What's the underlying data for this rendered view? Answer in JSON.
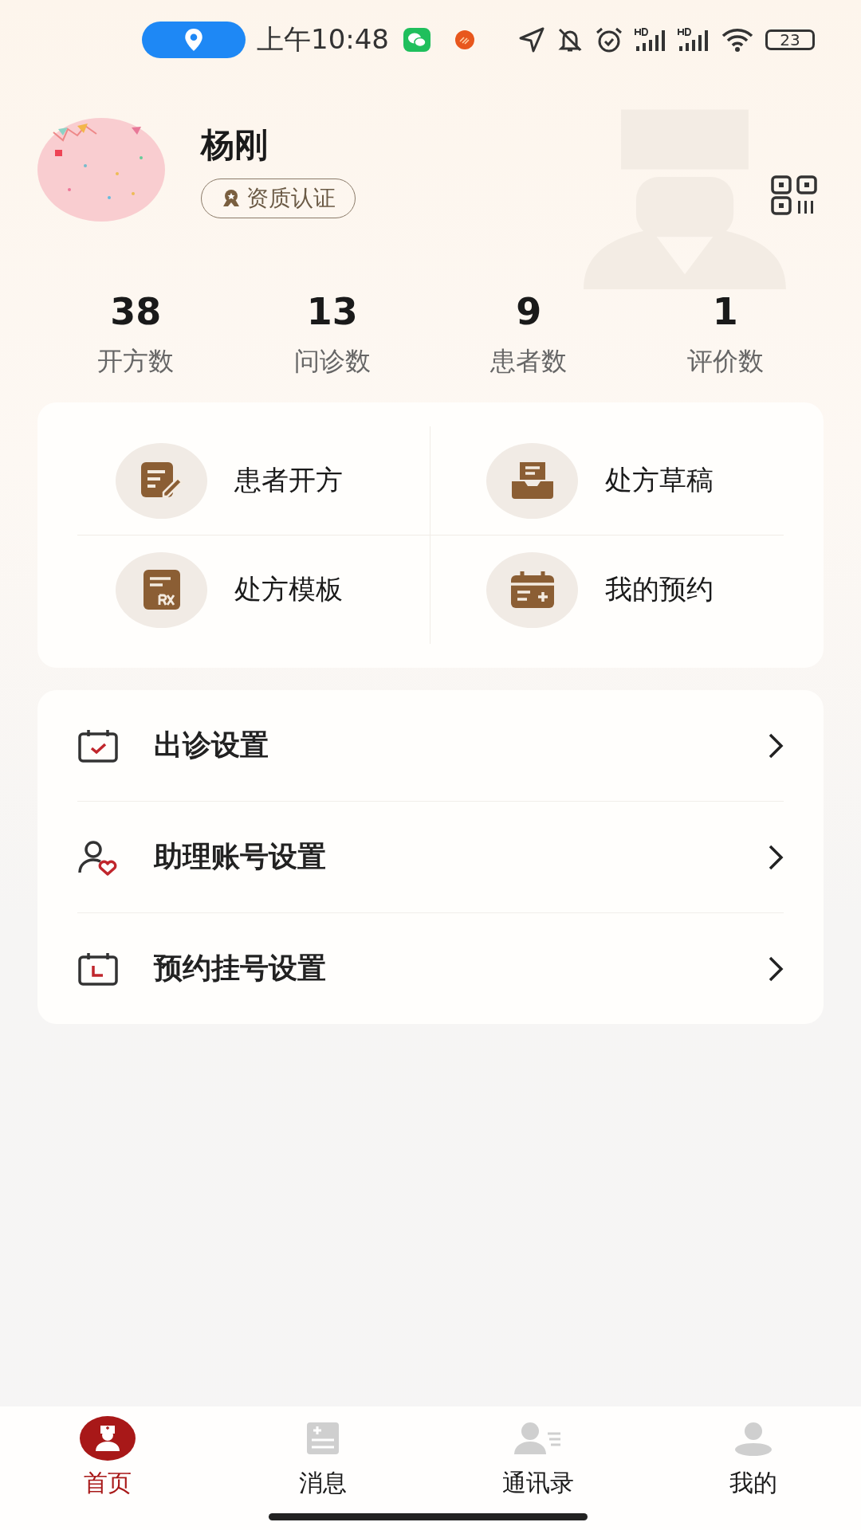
{
  "status_bar": {
    "time": "上午10:48",
    "battery": "23"
  },
  "profile": {
    "name": "杨刚",
    "badge": "资质认证"
  },
  "stats": [
    {
      "value": "38",
      "label": "开方数"
    },
    {
      "value": "13",
      "label": "问诊数"
    },
    {
      "value": "9",
      "label": "患者数"
    },
    {
      "value": "1",
      "label": "评价数"
    }
  ],
  "shortcuts": [
    {
      "label": "患者开方",
      "kind": "prescribe"
    },
    {
      "label": "处方草稿",
      "kind": "draft"
    },
    {
      "label": "处方模板",
      "kind": "template"
    },
    {
      "label": "我的预约",
      "kind": "appointment"
    }
  ],
  "settings": [
    {
      "label": "出诊设置",
      "kind": "calendar-check"
    },
    {
      "label": "助理账号设置",
      "kind": "assistant"
    },
    {
      "label": "预约挂号设置",
      "kind": "calendar-clock"
    }
  ],
  "tabs": [
    {
      "label": "首页",
      "kind": "home",
      "selected": true
    },
    {
      "label": "消息",
      "kind": "message",
      "selected": false
    },
    {
      "label": "通讯录",
      "kind": "contacts",
      "selected": false
    },
    {
      "label": "我的",
      "kind": "me",
      "selected": false
    }
  ]
}
